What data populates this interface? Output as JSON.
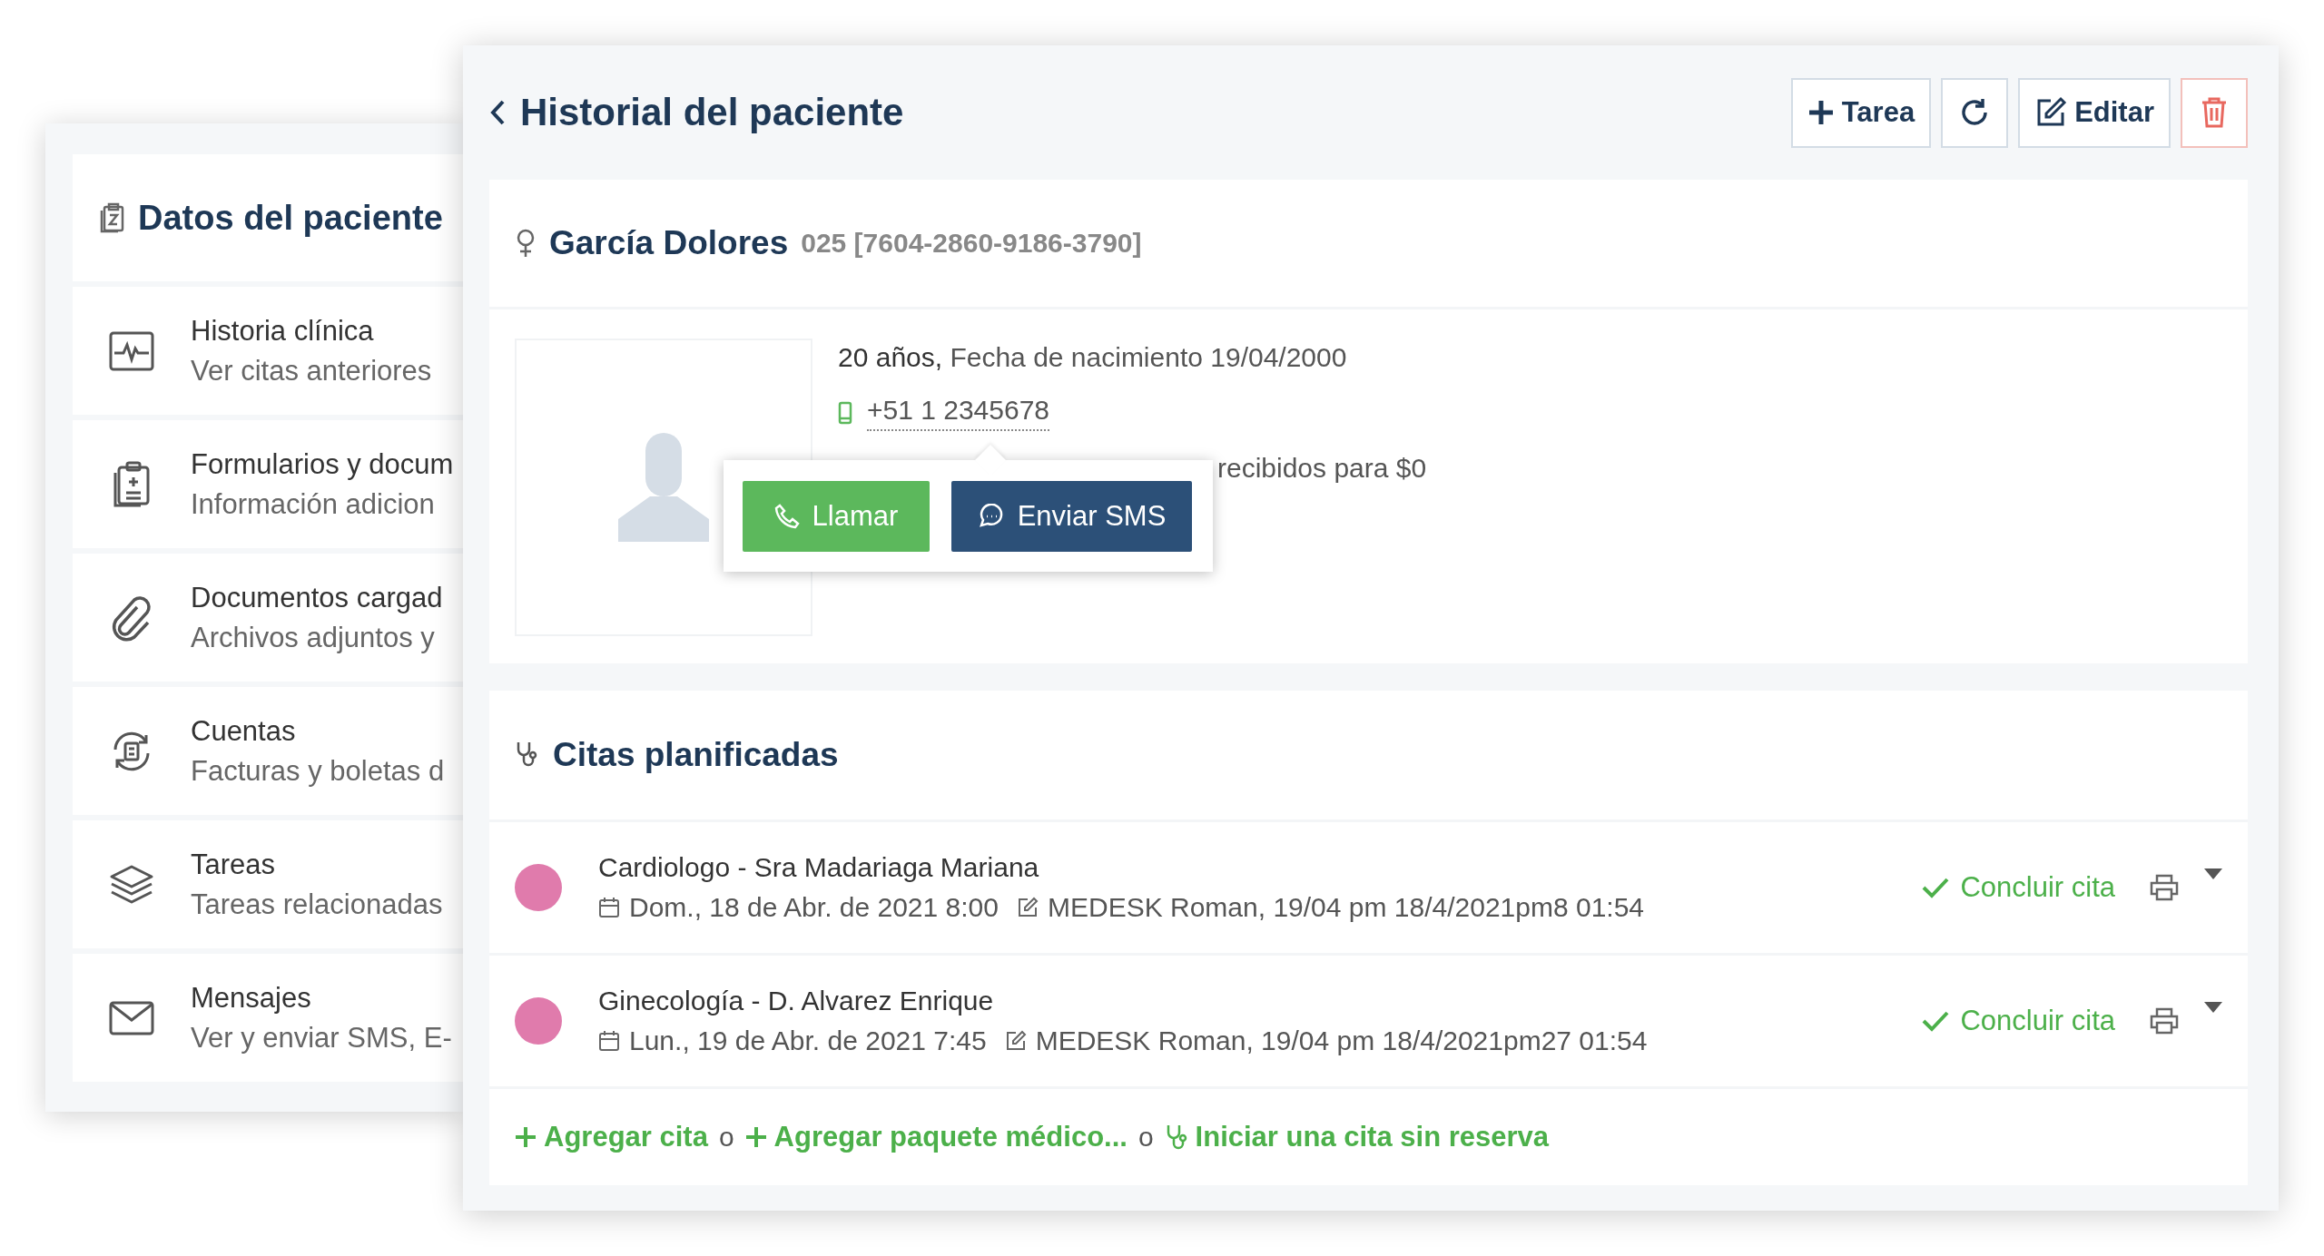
{
  "side_panel": {
    "title": "Datos del paciente",
    "items": [
      {
        "kind": "pulse",
        "title": "Historia clínica",
        "subtitle": "Ver citas anteriores"
      },
      {
        "kind": "clipboard",
        "title": "Formularios y docum",
        "subtitle": "Información adicion"
      },
      {
        "kind": "paperclip",
        "title": "Documentos cargad",
        "subtitle": "Archivos adjuntos y"
      },
      {
        "kind": "billing",
        "title": "Cuentas",
        "subtitle": "Facturas y boletas d"
      },
      {
        "kind": "layers",
        "title": "Tareas",
        "subtitle": "Tareas relacionadas"
      },
      {
        "kind": "mail",
        "title": "Mensajes",
        "subtitle": "Ver y enviar SMS, E-"
      }
    ]
  },
  "history": {
    "title": "Historial del paciente",
    "buttons": [
      {
        "kind": "task",
        "label": "Tarea"
      },
      {
        "kind": "refresh"
      },
      {
        "kind": "edit",
        "label": "Editar"
      },
      {
        "kind": "delete"
      }
    ],
    "patient": {
      "name": "García Dolores",
      "record": "025 [7604-2860-9186-3790]",
      "age": "20 años,",
      "birth": "Fecha de nacimiento 19/04/2000",
      "phone": "+51 1 2345678",
      "balance_fragment": "recibidos para $0"
    },
    "phone_popover": {
      "call": "Llamar",
      "sms": "Enviar SMS"
    },
    "appointments": {
      "title": "Citas planificadas",
      "items": [
        {
          "title": "Cardiologo - Sra Madariaga Mariana",
          "color": "#e07bac",
          "date": "Dom., 18 de Abr. de 2021 8:00",
          "author": "MEDESK Roman, 19/04 pm 18/4/2021pm8 01:54",
          "action": "Concluir cita"
        },
        {
          "title": "Ginecología - D. Alvarez Enrique",
          "color": "#e07bac",
          "date": "Lun., 19 de Abr. de 2021 7:45",
          "author": "MEDESK Roman, 19/04 pm 18/4/2021pm27 01:54",
          "action": "Concluir cita"
        }
      ],
      "links": [
        {
          "kind": "add",
          "label": "Agregar cita"
        },
        {
          "kind": "or",
          "label": "o"
        },
        {
          "kind": "add",
          "label": "Agregar paquete médico..."
        },
        {
          "kind": "or",
          "label": "o"
        },
        {
          "kind": "walkin",
          "label": "Iniciar una cita sin reserva"
        }
      ]
    }
  }
}
